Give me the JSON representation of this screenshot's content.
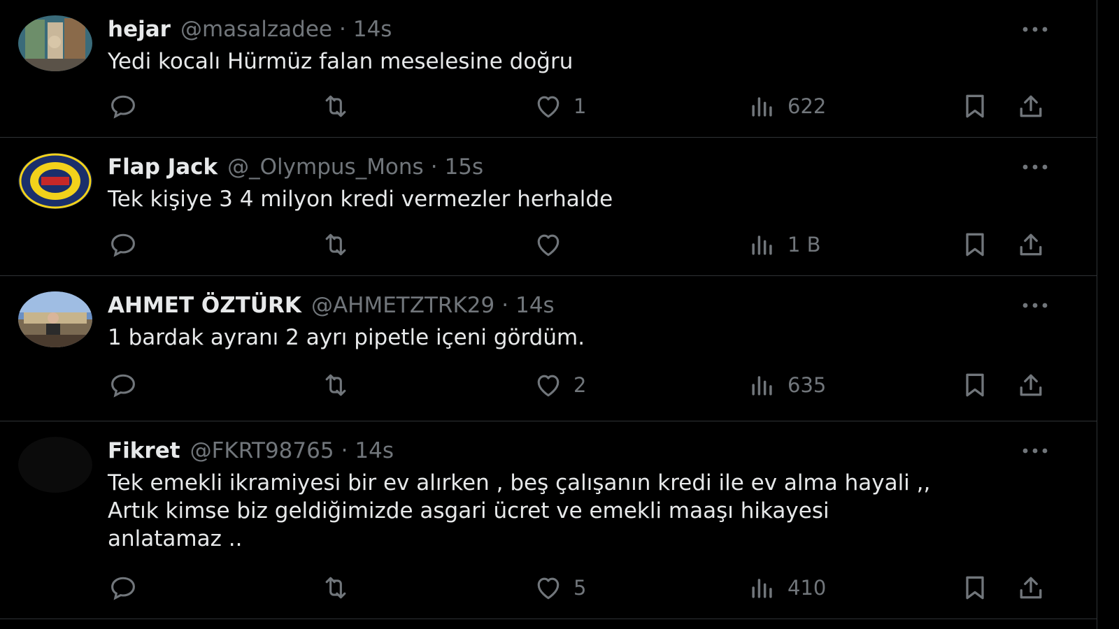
{
  "tweets": [
    {
      "name": "hejar",
      "handle": "@masalzadee",
      "time": "14s",
      "text": [
        "Yedi kocalı Hürmüz falan meselesine doğru"
      ],
      "replies": "",
      "retweets": "",
      "likes": "1",
      "views": "622",
      "avatar_colors": [
        "#3a6b7a",
        "#c9b79a"
      ]
    },
    {
      "name": "Flap Jack",
      "handle": "@_Olympus_Mons",
      "time": "15s",
      "text": [
        "Tek kişiye 3 4 milyon kredi vermezler herhalde"
      ],
      "replies": "",
      "retweets": "",
      "likes": "",
      "views": "1 B",
      "avatar_colors": [
        "#1a2f6b",
        "#f2d21b"
      ]
    },
    {
      "name": "AHMET ÖZTÜRK",
      "handle": "@AHMETZTRK29",
      "time": "14s",
      "text": [
        "1 bardak ayranı 2 ayrı pipetle içeni gördüm."
      ],
      "replies": "",
      "retweets": "",
      "likes": "2",
      "views": "635",
      "avatar_colors": [
        "#6b90c4",
        "#4a3b2e"
      ]
    },
    {
      "name": "Fikret",
      "handle": "@FKRT98765",
      "time": "14s",
      "text": [
        "Tek emekli ikramiyesi bir ev alırken , beş çalışanın  kredi ile ev alma hayali ,,",
        "Artık kimse biz geldiğimizde asgari ücret ve emekli maaşı hikayesi",
        "anlatamaz .."
      ],
      "replies": "",
      "retweets": "",
      "likes": "5",
      "views": "410",
      "avatar_colors": [
        "#0b0b0b",
        "#0b0b0b"
      ]
    }
  ],
  "separator": "·",
  "icons": {
    "more": "more-icon",
    "reply": "reply-icon",
    "retweet": "retweet-icon",
    "like": "heart-icon",
    "views": "views-icon",
    "bookmark": "bookmark-icon",
    "share": "share-icon"
  },
  "colors": {
    "background": "#000000",
    "text": "#e7e9ea",
    "secondary": "#71767b",
    "border": "#2f3336"
  }
}
